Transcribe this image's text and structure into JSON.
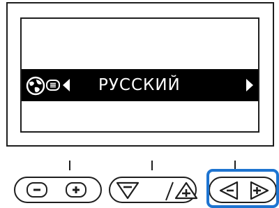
{
  "screen": {
    "language_label": "РУССКИЙ",
    "globe_icon": "globe-icon",
    "menu_icon": "menu-list-icon",
    "prev_icon": "triangle-left-icon",
    "next_icon": "triangle-right-icon"
  },
  "controls": {
    "minus_icon": "minus-icon",
    "plus_icon": "plus-icon",
    "down_icon": "triangle-down-minus-icon",
    "up_icon": "triangle-up-plus-icon",
    "left_icon": "triangle-left-minus-icon",
    "right_icon": "triangle-right-plus-icon"
  },
  "colors": {
    "highlight": "#1e74d0",
    "selection_bar": "#000000",
    "outline": "#1e1e1e"
  }
}
